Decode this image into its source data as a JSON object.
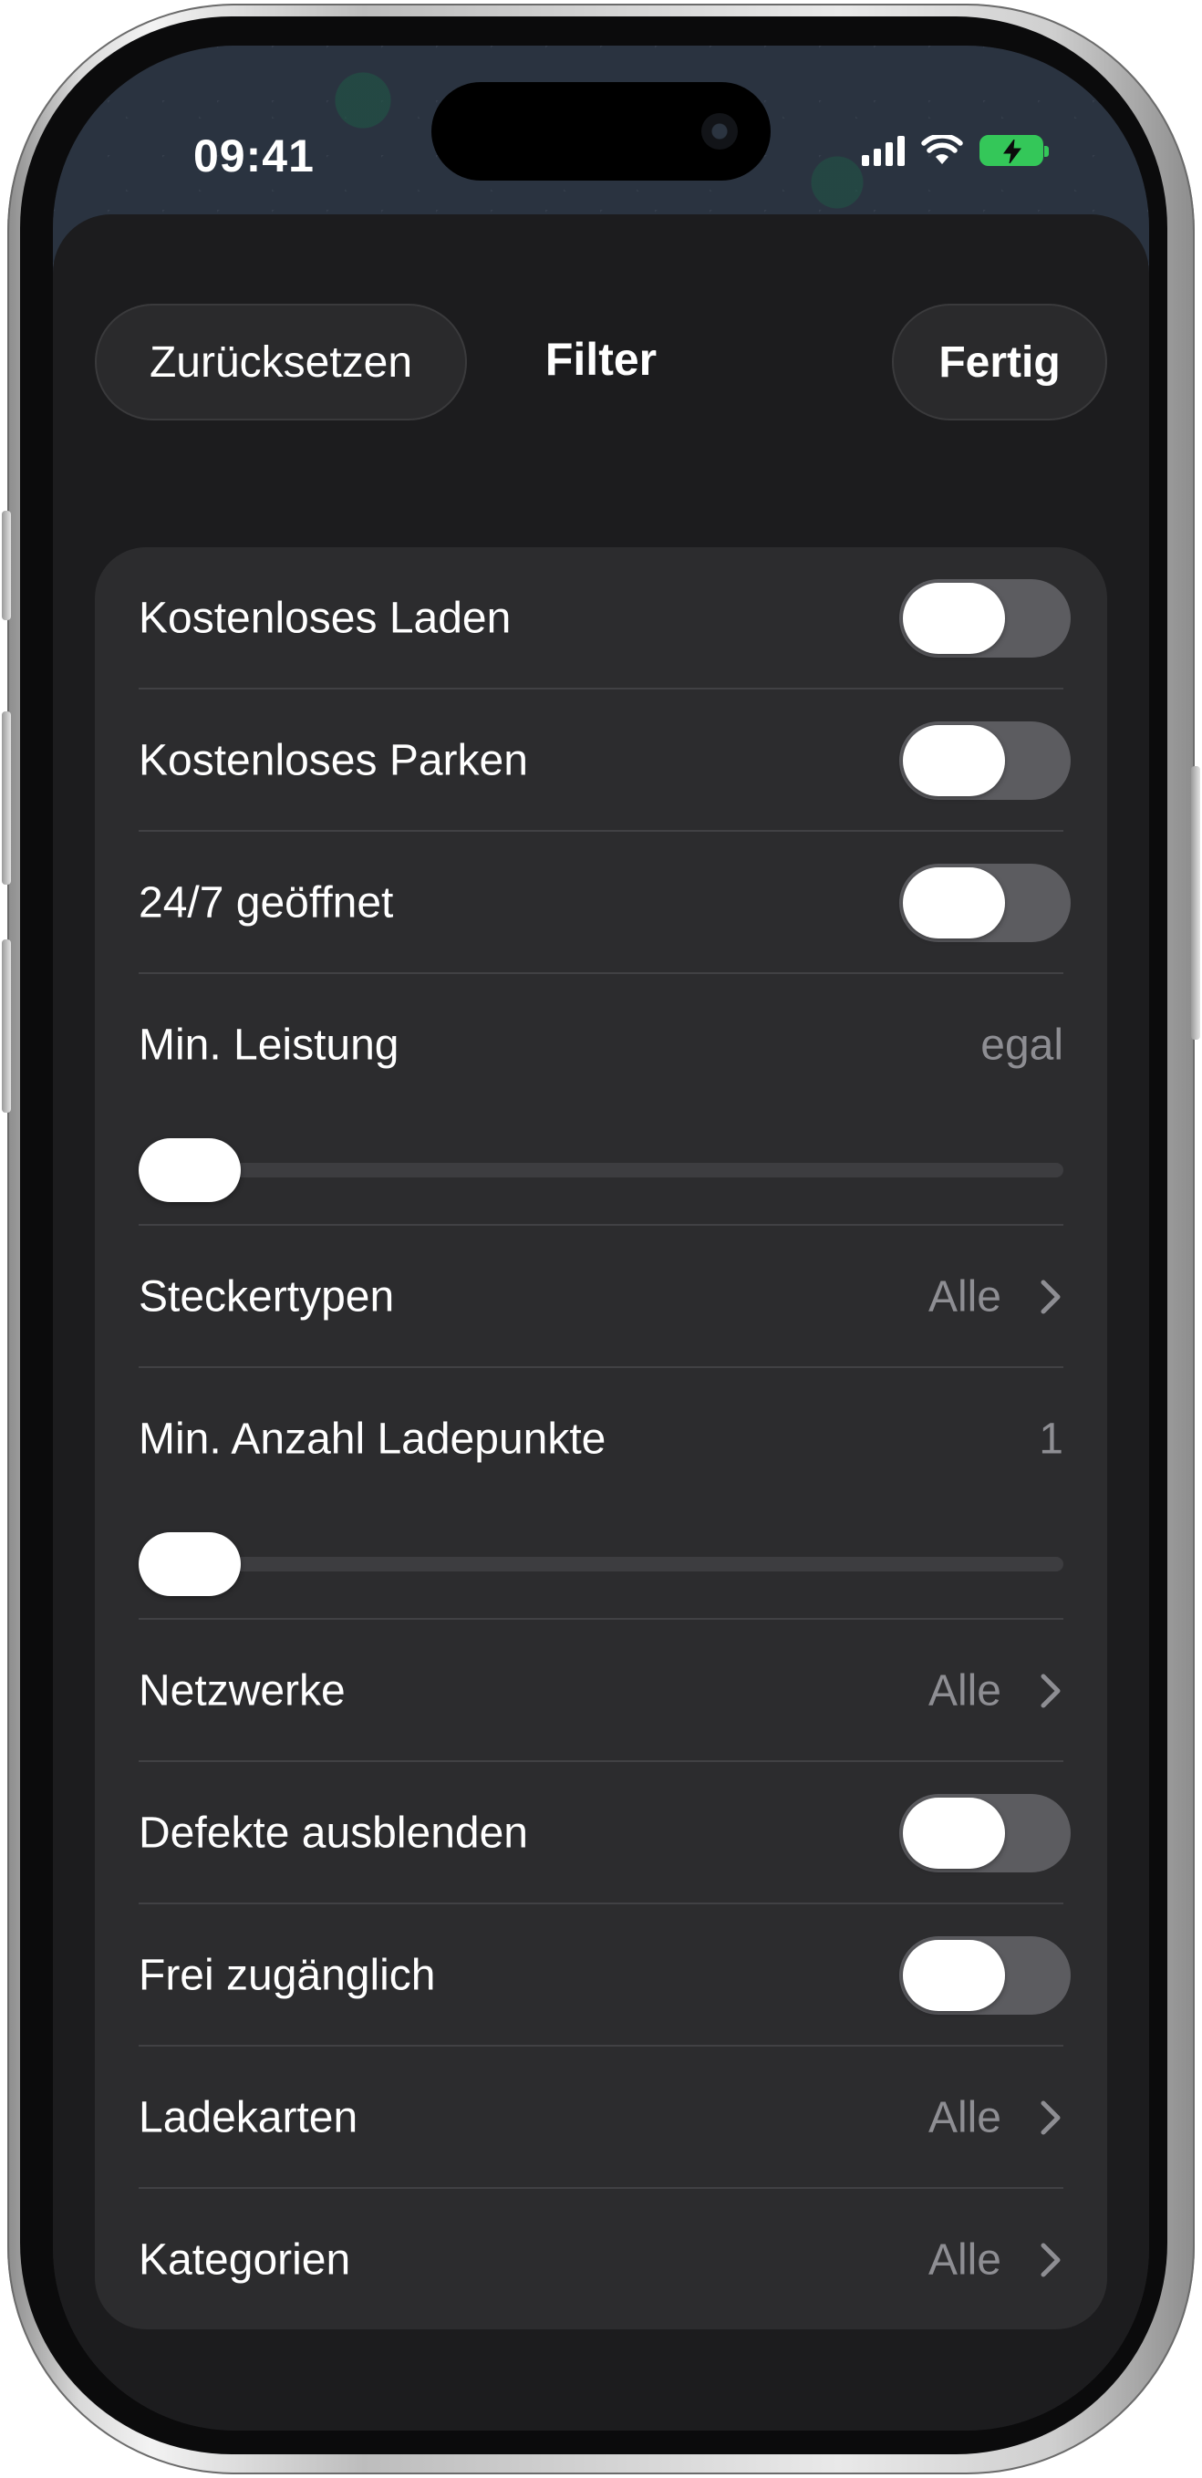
{
  "status_bar": {
    "time": "09:41"
  },
  "header": {
    "reset_label": "Zurücksetzen",
    "title": "Filter",
    "done_label": "Fertig"
  },
  "filters": {
    "free_charging": {
      "label": "Kostenloses Laden",
      "on": false
    },
    "free_parking": {
      "label": "Kostenloses Parken",
      "on": false
    },
    "open_24_7": {
      "label": "24/7 geöffnet",
      "on": false
    },
    "min_power": {
      "label": "Min. Leistung",
      "value": "egal",
      "level": 0
    },
    "connector_types": {
      "label": "Steckertypen",
      "value": "Alle"
    },
    "min_charge_points": {
      "label": "Min. Anzahl Ladepunkte",
      "value": "1",
      "level": 0
    },
    "networks": {
      "label": "Netzwerke",
      "value": "Alle"
    },
    "hide_defective": {
      "label": "Defekte ausblenden",
      "on": false
    },
    "free_access": {
      "label": "Frei zugänglich",
      "on": false
    },
    "charge_cards": {
      "label": "Ladekarten",
      "value": "Alle"
    },
    "categories": {
      "label": "Kategorien",
      "value": "Alle"
    }
  },
  "colors": {
    "sheet_bg": "#1c1c1e",
    "card_bg": "#2c2c2e",
    "toggle_off": "#5c5c60",
    "secondary_text": "#8e8e93",
    "battery": "#34c759"
  },
  "icons": [
    "signal-icon",
    "wifi-icon",
    "battery-charging-icon",
    "chevron-right-icon"
  ]
}
